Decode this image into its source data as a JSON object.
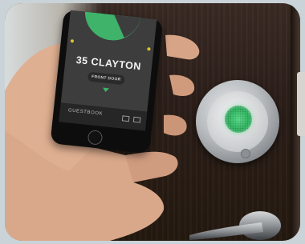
{
  "phone_screen": {
    "lock_name": "35 CLAYTON",
    "door_label": "FRONT DOOR",
    "footer_label": "GUESTBOOK"
  },
  "colors": {
    "accent_green": "#3fb36a",
    "lock_led": "#33b865"
  }
}
